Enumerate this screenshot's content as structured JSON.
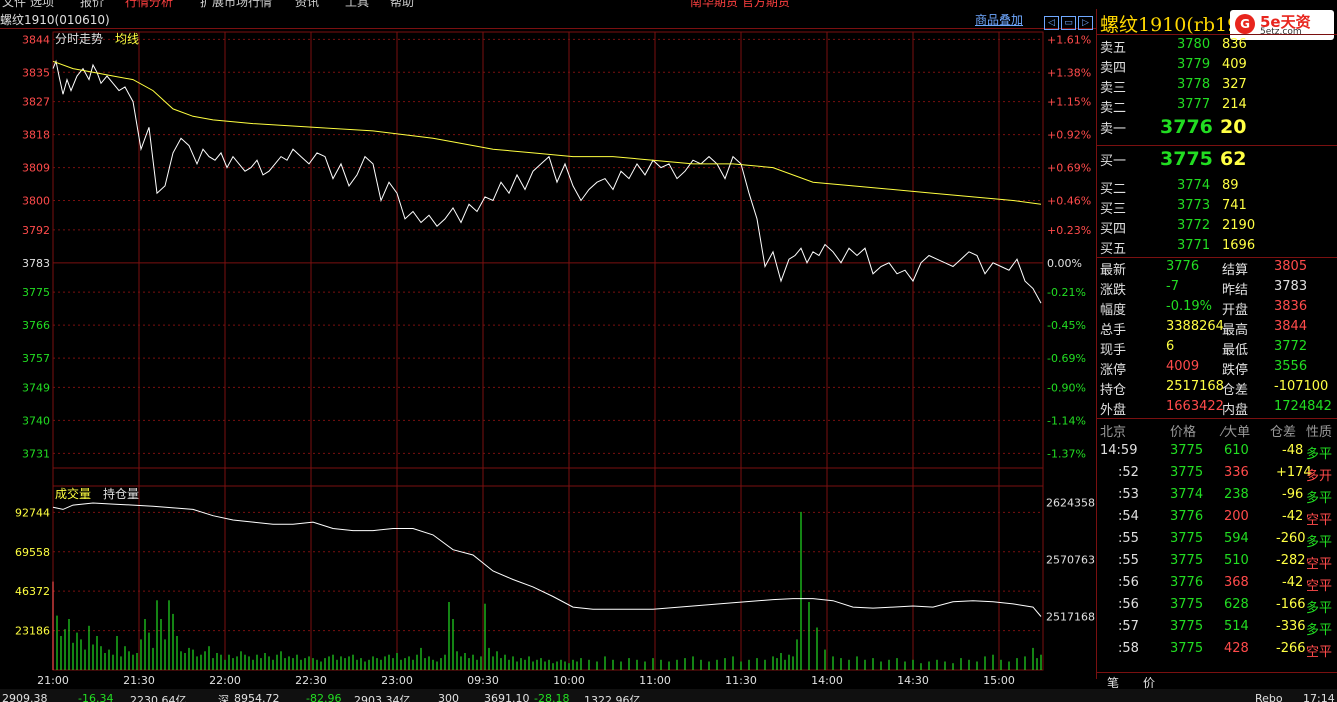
{
  "menu": {
    "items": [
      "文件",
      "选项",
      "报价",
      "行情分析",
      "扩展市场行情",
      "资讯",
      "工具",
      "帮助"
    ],
    "banner": "南华期货 官方期货"
  },
  "header": {
    "contract": "螺纹1910(010610)",
    "overlay_label": "商品叠加",
    "buttons": [
      "◁",
      "▭",
      "▷"
    ]
  },
  "chart_data": [
    {
      "type": "line",
      "legend": [
        "分时走势",
        "均线"
      ],
      "x_ticks": [
        "21:00",
        "21:30",
        "22:00",
        "22:30",
        "23:00",
        "09:30",
        "10:00",
        "11:00",
        "11:30",
        "14:00",
        "14:30",
        "15:00"
      ],
      "y_ticks": [
        3844,
        3835,
        3827,
        3818,
        3809,
        3800,
        3792,
        3783,
        3775,
        3766,
        3757,
        3749,
        3740,
        3731
      ],
      "pct_ticks": [
        "+1.61%",
        "+1.38%",
        "+1.15%",
        "+0.92%",
        "+0.69%",
        "+0.46%",
        "+0.23%",
        "0.00%",
        "-0.21%",
        "-0.45%",
        "-0.69%",
        "-0.90%",
        "-1.14%",
        "-1.37%"
      ],
      "ylim": [
        3727,
        3846
      ],
      "prev_settle": 3783,
      "series": [
        {
          "name": "分时走势",
          "color": "#ffffff",
          "x": [
            0,
            3,
            6,
            10,
            14,
            18,
            24,
            30,
            36,
            40,
            44,
            48,
            54,
            60,
            66,
            72,
            80,
            88,
            96,
            104,
            112,
            120,
            128,
            136,
            144,
            150,
            156,
            162,
            168,
            174,
            180,
            186,
            192,
            198,
            204,
            210,
            216,
            222,
            228,
            234,
            240,
            248,
            256,
            264,
            272,
            280,
            288,
            296,
            304,
            312,
            320,
            328,
            336,
            344,
            352,
            360,
            368,
            376,
            384,
            392,
            400,
            408,
            416,
            424,
            432,
            440,
            448,
            456,
            464,
            472,
            480,
            488,
            496,
            504,
            512,
            520,
            528,
            536,
            544,
            552,
            560,
            568,
            576,
            584,
            592,
            600,
            608,
            616,
            624,
            632,
            640,
            648,
            656,
            664,
            672,
            680,
            688,
            696,
            704,
            712,
            720,
            728,
            736,
            742,
            748,
            754,
            760,
            766,
            772,
            780,
            788,
            796,
            804,
            812,
            820,
            828,
            836,
            844,
            852,
            860,
            868,
            876,
            884,
            892,
            900,
            908,
            916,
            924,
            932,
            940,
            948,
            956,
            964,
            972,
            980,
            988
          ],
          "y": [
            3836,
            3838,
            3834,
            3829,
            3833,
            3830,
            3834,
            3836,
            3833,
            3837,
            3835,
            3832,
            3834,
            3832,
            3830,
            3831,
            3827,
            3814,
            3820,
            3802,
            3804,
            3813,
            3817,
            3815,
            3810,
            3814,
            3812,
            3811,
            3813,
            3809,
            3812,
            3810,
            3808,
            3809,
            3811,
            3807,
            3808,
            3810,
            3812,
            3811,
            3814,
            3812,
            3810,
            3813,
            3812,
            3806,
            3810,
            3804,
            3807,
            3812,
            3810,
            3800,
            3805,
            3802,
            3795,
            3797,
            3794,
            3796,
            3793,
            3795,
            3798,
            3794,
            3799,
            3797,
            3801,
            3800,
            3805,
            3802,
            3807,
            3803,
            3808,
            3810,
            3812,
            3805,
            3810,
            3804,
            3800,
            3803,
            3805,
            3806,
            3803,
            3808,
            3806,
            3810,
            3807,
            3811,
            3809,
            3810,
            3806,
            3808,
            3811,
            3810,
            3812,
            3810,
            3806,
            3812,
            3810,
            3802,
            3795,
            3782,
            3786,
            3778,
            3784,
            3785,
            3787,
            3783,
            3786,
            3785,
            3788,
            3786,
            3783,
            3787,
            3785,
            3787,
            3780,
            3782,
            3783,
            3780,
            3781,
            3778,
            3783,
            3785,
            3784,
            3783,
            3782,
            3784,
            3786,
            3785,
            3780,
            3783,
            3782,
            3781,
            3784,
            3778,
            3776,
            3772
          ]
        },
        {
          "name": "均线",
          "color": "#ffff40",
          "x": [
            0,
            20,
            40,
            60,
            80,
            100,
            120,
            140,
            160,
            200,
            260,
            320,
            380,
            400,
            440,
            480,
            520,
            560,
            600,
            640,
            680,
            720,
            760,
            800,
            840,
            880,
            920,
            960,
            988
          ],
          "y": [
            3838,
            3836,
            3835,
            3834,
            3833,
            3830,
            3825,
            3823,
            3822,
            3821,
            3820,
            3819,
            3817,
            3816,
            3814,
            3813,
            3812,
            3812,
            3811,
            3810,
            3810,
            3809,
            3805,
            3804,
            3803,
            3802,
            3801,
            3800,
            3799
          ]
        }
      ]
    },
    {
      "type": "bar",
      "legend": [
        "成交量",
        "持仓量"
      ],
      "y_ticks": [
        92744,
        69558,
        46372,
        23186
      ],
      "oi_ticks": [
        2624358,
        2570763,
        2517168
      ],
      "ylim": [
        0,
        100000
      ],
      "oi_lim": [
        2495000,
        2640000
      ],
      "volume_color": "#22dd22",
      "volume_hot_color": "#ff4b4b",
      "volume_x": [
        0,
        4,
        8,
        12,
        16,
        20,
        24,
        28,
        32,
        36,
        40,
        44,
        48,
        52,
        56,
        60,
        64,
        68,
        72,
        76,
        80,
        84,
        88,
        92,
        96,
        100,
        104,
        108,
        112,
        116,
        120,
        124,
        128,
        132,
        136,
        140,
        144,
        148,
        152,
        156,
        160,
        164,
        168,
        172,
        176,
        180,
        184,
        188,
        192,
        196,
        200,
        204,
        208,
        212,
        216,
        220,
        224,
        228,
        232,
        236,
        240,
        244,
        248,
        252,
        256,
        260,
        264,
        268,
        272,
        276,
        280,
        284,
        288,
        292,
        296,
        300,
        304,
        308,
        312,
        316,
        320,
        324,
        328,
        332,
        336,
        340,
        344,
        348,
        352,
        356,
        360,
        364,
        368,
        372,
        376,
        380,
        384,
        388,
        392,
        396,
        400,
        404,
        408,
        412,
        416,
        420,
        424,
        428,
        432,
        436,
        440,
        444,
        448,
        452,
        456,
        460,
        464,
        468,
        472,
        476,
        480,
        484,
        488,
        492,
        496,
        500,
        504,
        508,
        512,
        516,
        520,
        524,
        528,
        536,
        544,
        552,
        560,
        568,
        576,
        584,
        592,
        600,
        608,
        616,
        624,
        632,
        640,
        648,
        656,
        664,
        672,
        680,
        688,
        696,
        704,
        712,
        720,
        724,
        728,
        732,
        736,
        740,
        744,
        748,
        756,
        764,
        772,
        780,
        788,
        796,
        804,
        812,
        820,
        828,
        836,
        844,
        852,
        860,
        868,
        876,
        884,
        892,
        900,
        908,
        916,
        924,
        932,
        940,
        948,
        956,
        964,
        972,
        980,
        984,
        988
      ],
      "volume": [
        52000,
        32000,
        20000,
        24000,
        30000,
        16000,
        22000,
        18000,
        12000,
        26000,
        15000,
        20000,
        14000,
        10000,
        12000,
        9000,
        20000,
        8000,
        14000,
        11000,
        9000,
        10000,
        18000,
        30000,
        22000,
        13000,
        41000,
        30000,
        18000,
        41000,
        33000,
        20000,
        11000,
        10000,
        13000,
        12000,
        8000,
        9000,
        11000,
        14000,
        7000,
        10000,
        9000,
        6000,
        9000,
        7000,
        8000,
        11000,
        9000,
        8000,
        6000,
        9000,
        7000,
        10000,
        8000,
        6000,
        9000,
        11000,
        7000,
        8000,
        7000,
        9000,
        6000,
        7000,
        8000,
        7000,
        6000,
        5000,
        7000,
        8000,
        9000,
        6000,
        8000,
        7000,
        8000,
        9000,
        6000,
        7000,
        5000,
        6000,
        8000,
        7000,
        6000,
        8000,
        9000,
        7000,
        10000,
        6000,
        7000,
        8000,
        6000,
        9000,
        13000,
        7000,
        8000,
        6000,
        5000,
        7000,
        9000,
        40000,
        30000,
        11000,
        8000,
        10000,
        7000,
        9000,
        6000,
        8000,
        39000,
        13000,
        8000,
        11000,
        7000,
        9000,
        6000,
        8000,
        5000,
        7000,
        6000,
        8000,
        5000,
        6000,
        7000,
        5000,
        6000,
        4000,
        5000,
        6000,
        5000,
        4000,
        6000,
        5000,
        7000,
        6000,
        5000,
        8000,
        6000,
        5000,
        7000,
        6000,
        5000,
        7000,
        6000,
        5000,
        6000,
        7000,
        8000,
        6000,
        5000,
        6000,
        7000,
        8000,
        5000,
        6000,
        7000,
        6000,
        8000,
        7000,
        10000,
        6000,
        9000,
        8000,
        18000,
        93000,
        40000,
        25000,
        12000,
        8000,
        7000,
        6000,
        8000,
        6000,
        7000,
        5000,
        6000,
        7000,
        5000,
        6000,
        4000,
        5000,
        6000,
        5000,
        4000,
        7000,
        6000,
        5000,
        8000,
        9000,
        6000,
        5000,
        7000,
        8000,
        13000,
        7000,
        9000,
        12000,
        10000,
        14000,
        36000,
        26000,
        32000
      ],
      "oi_x": [
        0,
        10,
        20,
        40,
        60,
        80,
        100,
        140,
        160,
        180,
        200,
        220,
        240,
        260,
        280,
        300,
        320,
        340,
        360,
        380,
        400,
        420,
        440,
        460,
        480,
        500,
        520,
        540,
        560,
        600,
        640,
        680,
        720,
        740,
        760,
        780,
        800,
        820,
        840,
        860,
        880,
        900,
        920,
        940,
        960,
        980,
        988
      ],
      "oi": [
        2620000,
        2618000,
        2622000,
        2624000,
        2623000,
        2622000,
        2621000,
        2618000,
        2612000,
        2608000,
        2606000,
        2604000,
        2604000,
        2606000,
        2600000,
        2598000,
        2598000,
        2600000,
        2600000,
        2594000,
        2580000,
        2575000,
        2560000,
        2552000,
        2545000,
        2536000,
        2526000,
        2524000,
        2524000,
        2524000,
        2527000,
        2530000,
        2533000,
        2534000,
        2534000,
        2532000,
        2526000,
        2525000,
        2526000,
        2527000,
        2526000,
        2531000,
        2532000,
        2531000,
        2529000,
        2526000,
        2517168
      ]
    }
  ],
  "panel": {
    "title": "螺纹1910(rb1910)",
    "logo_text": "5e天资",
    "logo_sub": "5etz.com",
    "asks": [
      {
        "label": "卖五",
        "price": "3780",
        "vol": "836"
      },
      {
        "label": "卖四",
        "price": "3779",
        "vol": "409"
      },
      {
        "label": "卖三",
        "price": "3778",
        "vol": "327"
      },
      {
        "label": "卖二",
        "price": "3777",
        "vol": "214"
      },
      {
        "label": "卖一",
        "price": "3776",
        "vol": "20"
      }
    ],
    "bids": [
      {
        "label": "买一",
        "price": "3775",
        "vol": "62"
      },
      {
        "label": "买二",
        "price": "3774",
        "vol": "89"
      },
      {
        "label": "买三",
        "price": "3773",
        "vol": "741"
      },
      {
        "label": "买四",
        "price": "3772",
        "vol": "2190"
      },
      {
        "label": "买五",
        "price": "3771",
        "vol": "1696"
      }
    ],
    "stats": [
      {
        "l1": "最新",
        "v1": "3776",
        "c1": "g",
        "l2": "结算",
        "v2": "3805",
        "c2": "r"
      },
      {
        "l1": "涨跌",
        "v1": "-7",
        "c1": "g",
        "l2": "昨结",
        "v2": "3783",
        "c2": "w"
      },
      {
        "l1": "幅度",
        "v1": "-0.19%",
        "c1": "g",
        "l2": "开盘",
        "v2": "3836",
        "c2": "r"
      },
      {
        "l1": "总手",
        "v1": "3388264",
        "c1": "y",
        "l2": "最高",
        "v2": "3844",
        "c2": "r"
      },
      {
        "l1": "现手",
        "v1": "6",
        "c1": "y",
        "l2": "最低",
        "v2": "3772",
        "c2": "g"
      },
      {
        "l1": "涨停",
        "v1": "4009",
        "c1": "r",
        "l2": "跌停",
        "v2": "3556",
        "c2": "g"
      },
      {
        "l1": "持仓",
        "v1": "2517168",
        "c1": "y",
        "l2": "仓差",
        "v2": "-107100",
        "c2": "y"
      },
      {
        "l1": "外盘",
        "v1": "1663422",
        "c1": "r",
        "l2": "内盘",
        "v2": "1724842",
        "c2": "g"
      }
    ],
    "ticks_header": [
      "北京",
      "价格",
      "⁄大单",
      "仓差",
      "性质"
    ],
    "ticks": [
      {
        "time": "14:59",
        "price": "3775",
        "vol": "610",
        "vc": "g",
        "oi": "-48",
        "nature": "多平",
        "nc": "g"
      },
      {
        "time": ":52",
        "price": "3775",
        "vol": "336",
        "vc": "r",
        "oi": "+174",
        "nature": "多开",
        "nc": "r"
      },
      {
        "time": ":53",
        "price": "3774",
        "vol": "238",
        "vc": "g",
        "oi": "-96",
        "nature": "多平",
        "nc": "g"
      },
      {
        "time": ":54",
        "price": "3776",
        "vol": "200",
        "vc": "r",
        "oi": "-42",
        "nature": "空平",
        "nc": "r"
      },
      {
        "time": ":55",
        "price": "3775",
        "vol": "594",
        "vc": "g",
        "oi": "-260",
        "nature": "多平",
        "nc": "g"
      },
      {
        "time": ":55",
        "price": "3775",
        "vol": "510",
        "vc": "g",
        "oi": "-282",
        "nature": "空平",
        "nc": "r"
      },
      {
        "time": ":56",
        "price": "3776",
        "vol": "368",
        "vc": "r",
        "oi": "-42",
        "nature": "空平",
        "nc": "r"
      },
      {
        "time": ":56",
        "price": "3775",
        "vol": "628",
        "vc": "g",
        "oi": "-166",
        "nature": "多平",
        "nc": "g"
      },
      {
        "time": ":57",
        "price": "3775",
        "vol": "514",
        "vc": "g",
        "oi": "-336",
        "nature": "多平",
        "nc": "g"
      },
      {
        "time": ":58",
        "price": "3775",
        "vol": "428",
        "vc": "r",
        "oi": "-266",
        "nature": "空平",
        "nc": "r"
      }
    ],
    "tabs": [
      "笔",
      "价"
    ]
  },
  "statusbar": [
    {
      "text": "2909.38",
      "c": "w"
    },
    {
      "text": "-16.34",
      "c": "g"
    },
    {
      "text": "2230.64亿",
      "c": "w"
    },
    {
      "text": "深",
      "c": "w"
    },
    {
      "text": "8954.72",
      "c": "w"
    },
    {
      "text": "-82.96",
      "c": "g"
    },
    {
      "text": "2903.34亿",
      "c": "w"
    },
    {
      "text": "300",
      "c": "w"
    },
    {
      "text": "3691.10",
      "c": "w"
    },
    {
      "text": "-28.18",
      "c": "g"
    },
    {
      "text": "1322.96亿",
      "c": "w"
    },
    {
      "text": "Rebo",
      "c": "w"
    },
    {
      "text": "17:14",
      "c": "w"
    }
  ]
}
